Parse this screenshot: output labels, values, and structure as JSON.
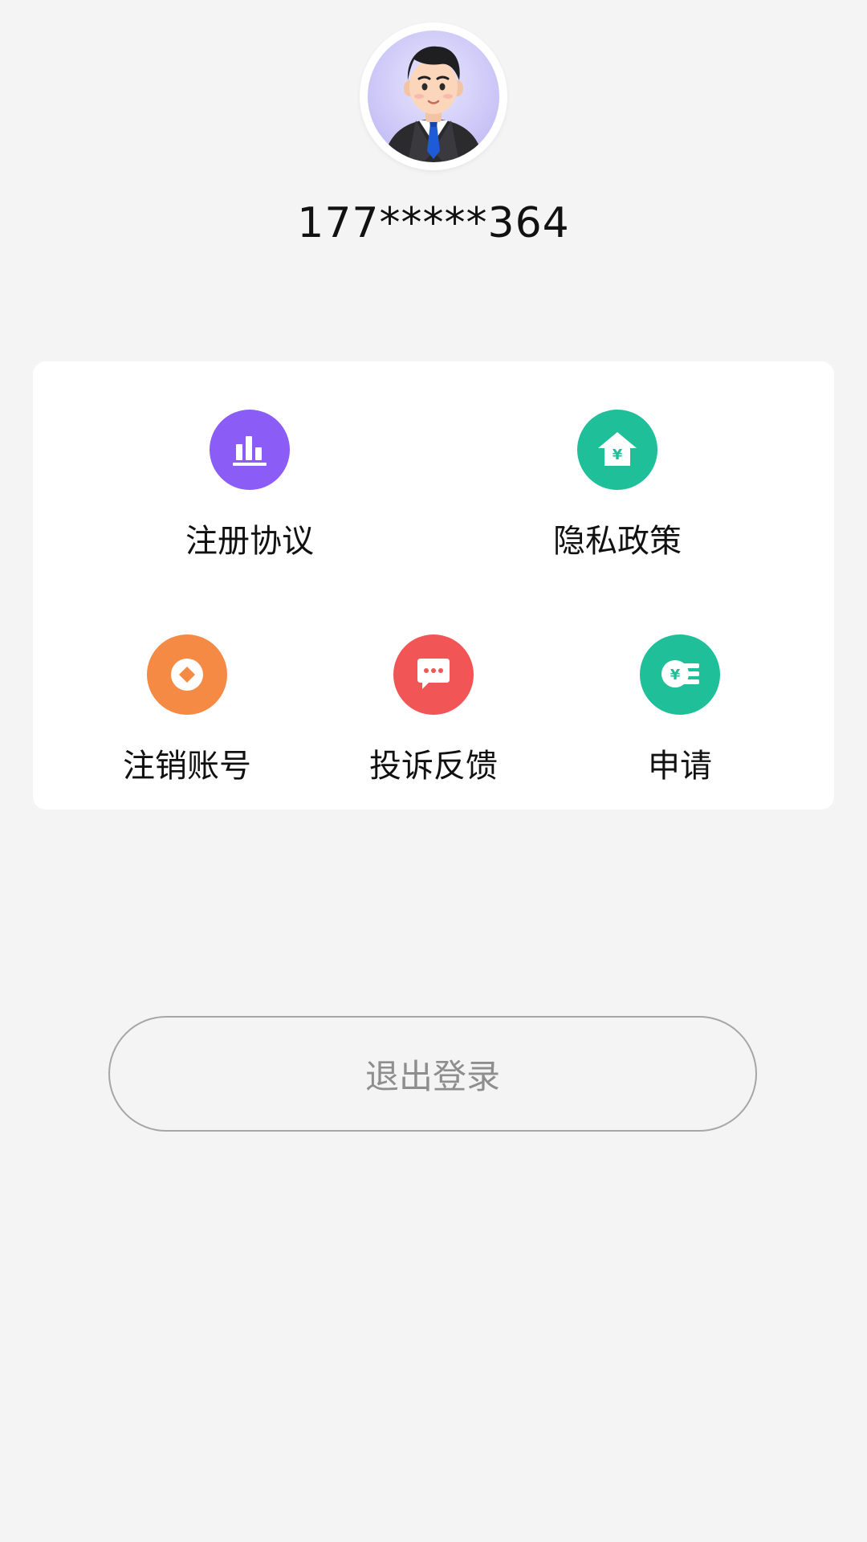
{
  "profile": {
    "phone": "177*****364",
    "avatar_icon": "businessman-avatar"
  },
  "menu": {
    "items": [
      {
        "label": "注册协议",
        "icon": "bar-chart-icon",
        "color": "#8b5cf6"
      },
      {
        "label": "隐私政策",
        "icon": "house-yen-icon",
        "color": "#1fbf9a"
      },
      {
        "label": "注销账号",
        "icon": "coin-icon",
        "color": "#f58a45"
      },
      {
        "label": "投诉反馈",
        "icon": "chat-bubble-icon",
        "color": "#f25555"
      },
      {
        "label": "申请",
        "icon": "yen-coins-icon",
        "color": "#1fbf9a"
      }
    ]
  },
  "logout": {
    "label": "退出登录"
  }
}
